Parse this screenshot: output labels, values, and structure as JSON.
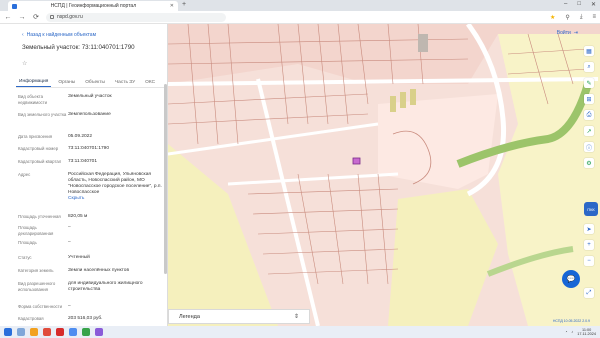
{
  "browser": {
    "tab_title": "НСПД | Геоинформационный портал",
    "url": "nspd.gov.ru"
  },
  "panel": {
    "back_label": "Назад к найденным объектам",
    "title": "Земельный участок: 73:11:040701:1790",
    "tabs": [
      "Информация",
      "Органы",
      "Объекты",
      "Часть ЗУ",
      "ОКС"
    ],
    "rows": [
      {
        "k": "Вид объекта недвижимости",
        "v": "Земельный участок"
      },
      {
        "k": "Вид земельного участка",
        "v": "Землепользование"
      },
      {
        "k": "Дата присвоения",
        "v": "05.09.2022"
      },
      {
        "k": "Кадастровый номер",
        "v": "73:11:040701:1790"
      },
      {
        "k": "Кадастровый квартал",
        "v": "73:11:040701"
      },
      {
        "k": "Адрес",
        "v": "Российская Федерация, Ульяновская область, Новоспасский район, МО \"Новоспасское городское поселение\", р.п. Новоспасское",
        "link": "Скрыть"
      },
      {
        "k": "Площадь уточненная",
        "v": "820,05 м"
      },
      {
        "k": "Площадь декларированная",
        "v": "–"
      },
      {
        "k": "Площадь",
        "v": "–"
      },
      {
        "k": "Статус",
        "v": "Учтенный"
      },
      {
        "k": "Категория земель",
        "v": "Земли населённых пунктов"
      },
      {
        "k": "Вид разрешенного использования",
        "v": "для индивидуального жилищного строительства"
      },
      {
        "k": "Форма собственности",
        "v": "–"
      },
      {
        "k": "Кадастровая",
        "v": "203 516,03 руб."
      }
    ]
  },
  "map": {
    "top_button": "Войти",
    "legend_label": "Легенда",
    "copyright": "НСПД 10.05.2022 2.0.9",
    "badge": "ПКК"
  },
  "taskbar": {
    "time": "11:00",
    "date": "17.11.2024"
  }
}
